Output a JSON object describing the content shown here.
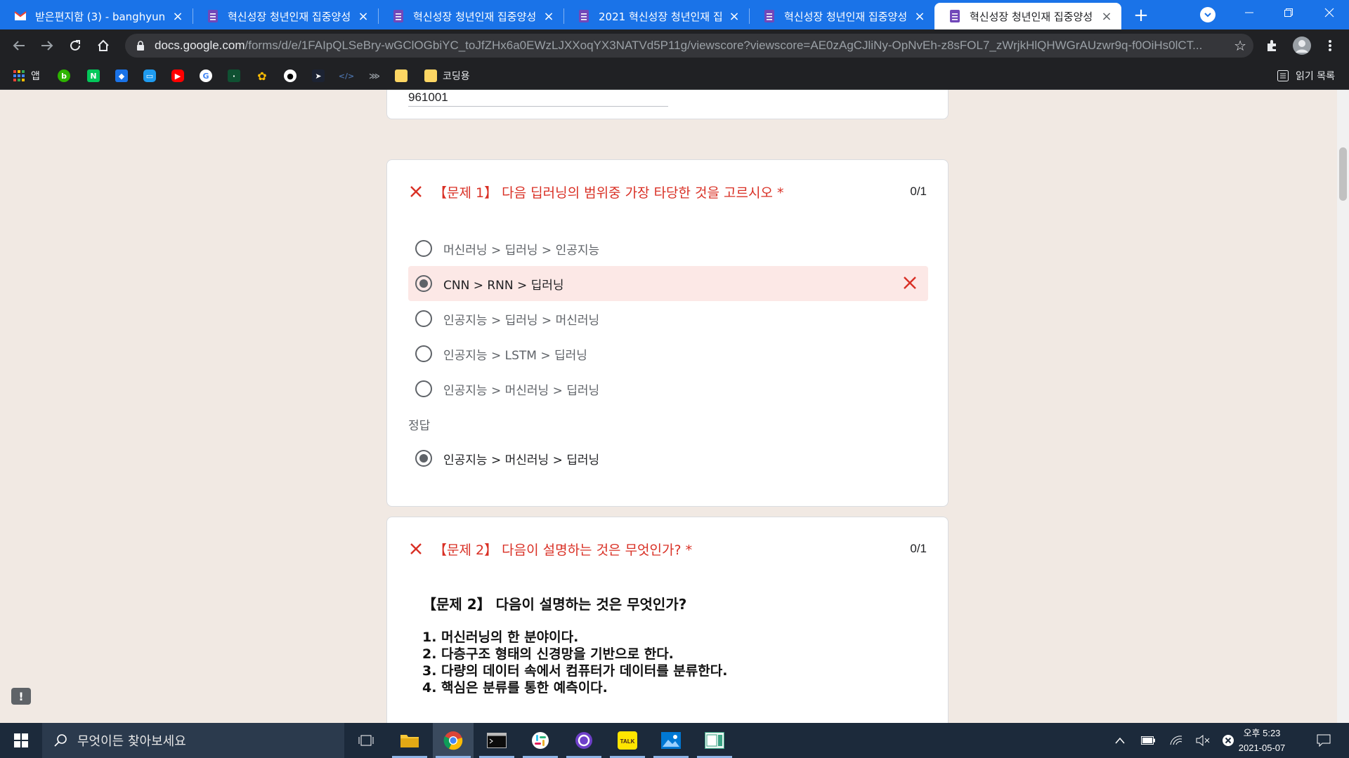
{
  "tabs": [
    {
      "title": "받은편지함 (3) - banghyun"
    },
    {
      "title": "혁신성장 청년인재 집중양성"
    },
    {
      "title": "혁신성장 청년인재 집중양성"
    },
    {
      "title": "2021 혁신성장 청년인재 집"
    },
    {
      "title": "혁신성장 청년인재 집중양성"
    },
    {
      "title": "혁신성장 청년인재 집중양성"
    }
  ],
  "toolbar": {
    "url_host": "docs.google.com",
    "url_path": "/forms/d/e/1FAIpQLSeBry-wGClOGbiYC_toJfZHx6a0EWzLJXXoqYX3NATVd5P11g/viewscore?viewscore=AE0zAgCJliNy-OpNvEh-z8sFOL7_zWrjkHlQHWGrAUzwr9q-f0OiHs0lCT..."
  },
  "bookmarks": {
    "apps": "앱",
    "coding": "코딩용",
    "reading_list": "읽기 목록"
  },
  "prev_card": {
    "answer_value": "961001"
  },
  "question1": {
    "title": "【문제 1】 다음 딥러닝의 범위중 가장 타당한 것을 고르시오 *",
    "score": "0/1",
    "options": [
      {
        "text": "머신러닝 > 딥러닝 > 인공지능"
      },
      {
        "text": "CNN > RNN > 딥러닝"
      },
      {
        "text": "인공지능 > 딥러닝 > 머신러닝"
      },
      {
        "text": "인공지능 > LSTM > 딥러닝"
      },
      {
        "text": "인공지능 > 머신러닝 > 딥러닝"
      }
    ],
    "selected_option_index": 1,
    "answer_label": "정답",
    "correct_answer": "인공지능 > 머신러닝 > 딥러닝"
  },
  "question2": {
    "title": "【문제 2】 다음이 설명하는 것은 무엇인가? *",
    "score": "0/1",
    "image_heading": "【문제 2】 다음이 설명하는 것은 무엇인가?",
    "image_lines": [
      "1. 머신러닝의 한 분야이다.",
      "2. 다층구조 형태의 신경망을 기반으로 한다.",
      "3. 다량의 데이터 속에서 컴퓨터가 데이터를 분류한다.",
      "4. 핵심은 분류를 통한 예측이다."
    ]
  },
  "taskbar": {
    "search_placeholder": "무엇이든 찾아보세요",
    "time": "오후 5:23",
    "date": "2021-05-07"
  },
  "colors": {
    "tab_strip": "#1a73e8",
    "error_red": "#d93025",
    "wrong_highlight": "#fce8e6",
    "page_bg": "#f1e9e3"
  }
}
